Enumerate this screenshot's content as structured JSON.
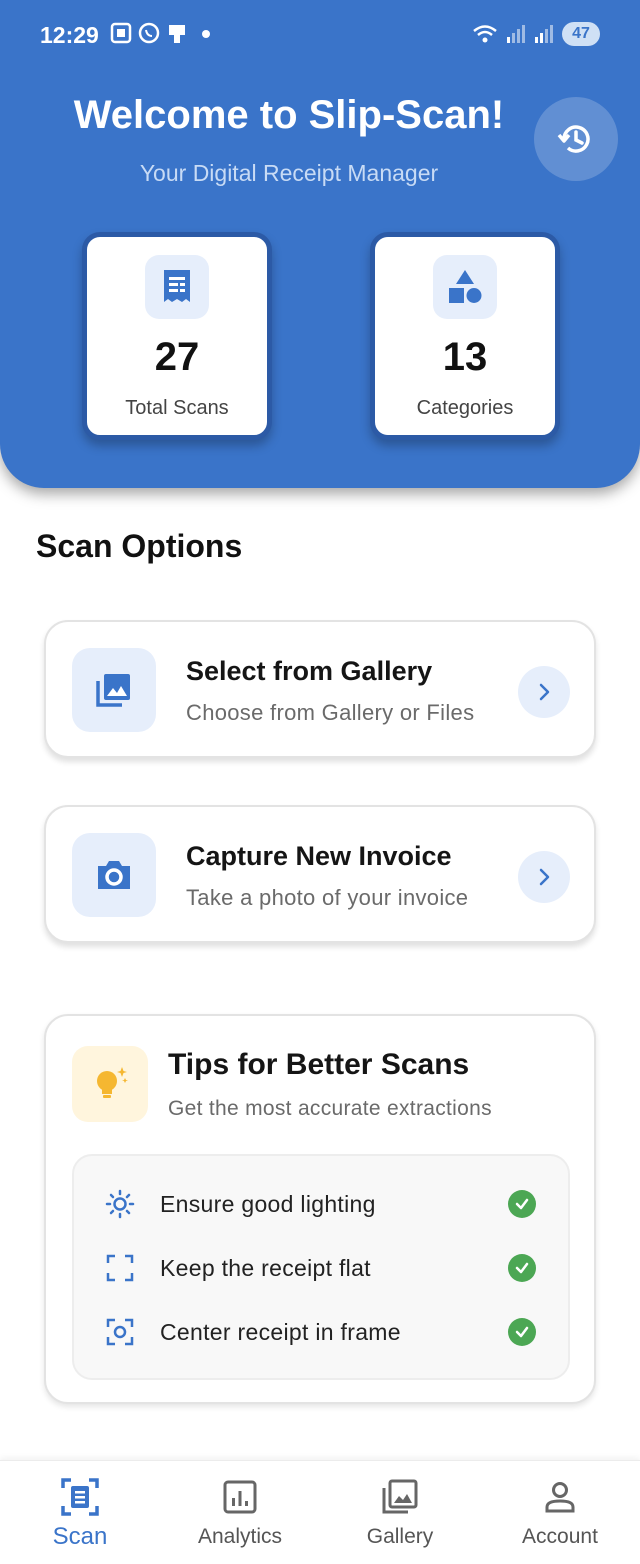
{
  "status_bar": {
    "time": "12:29",
    "battery": "47"
  },
  "header": {
    "title": "Welcome to Slip-Scan!",
    "subtitle": "Your Digital Receipt Manager",
    "background_color": "#3a74c9"
  },
  "stats": [
    {
      "value": "27",
      "label": "Total Scans",
      "icon": "receipt-icon"
    },
    {
      "value": "13",
      "label": "Categories",
      "icon": "category-shapes-icon"
    }
  ],
  "scan_options": {
    "title": "Scan Options",
    "items": [
      {
        "title": "Select from Gallery",
        "subtitle": "Choose from Gallery or Files",
        "icon": "gallery-icon"
      },
      {
        "title": "Capture New Invoice",
        "subtitle": "Take a photo of your invoice",
        "icon": "camera-icon"
      }
    ]
  },
  "tips": {
    "title": "Tips for Better Scans",
    "subtitle": "Get the most accurate extractions",
    "items": [
      {
        "text": "Ensure good lighting",
        "icon": "sun-icon"
      },
      {
        "text": "Keep the receipt flat",
        "icon": "crop-frame-icon"
      },
      {
        "text": "Center receipt in frame",
        "icon": "center-focus-icon"
      }
    ]
  },
  "nav": {
    "items": [
      {
        "label": "Scan",
        "icon": "scan-document-icon",
        "active": true
      },
      {
        "label": "Analytics",
        "icon": "analytics-icon",
        "active": false
      },
      {
        "label": "Gallery",
        "icon": "gallery-icon",
        "active": false
      },
      {
        "label": "Account",
        "icon": "account-icon",
        "active": false
      }
    ]
  },
  "colors": {
    "accent": "#3a74c9",
    "check": "#4ca754",
    "tip_icon": "#f5b731"
  }
}
